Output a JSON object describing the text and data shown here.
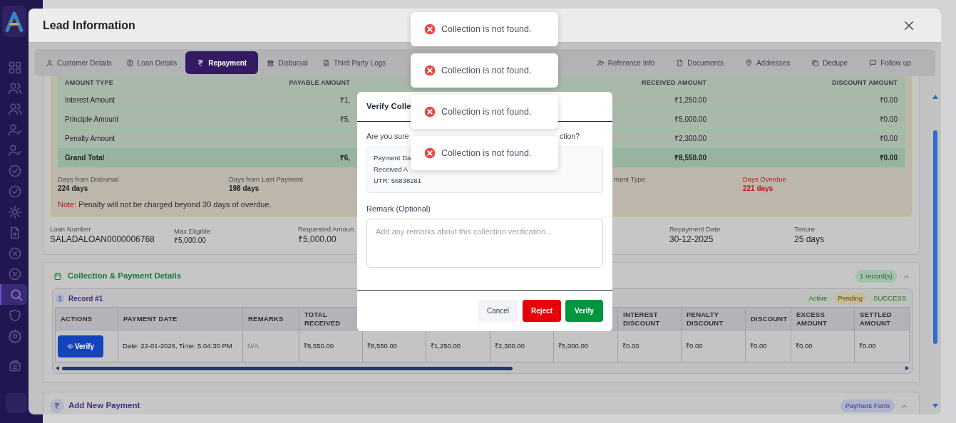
{
  "sidebar": {
    "items": [
      {
        "kind": "grid",
        "selected": false
      },
      {
        "kind": "users",
        "selected": false
      },
      {
        "kind": "users",
        "selected": false
      },
      {
        "kind": "user-check",
        "selected": false
      },
      {
        "kind": "user-check",
        "selected": false
      },
      {
        "kind": "check-circle",
        "selected": false
      },
      {
        "kind": "check-circle",
        "selected": false
      },
      {
        "kind": "sun",
        "selected": false
      },
      {
        "kind": "file",
        "selected": false
      },
      {
        "kind": "x-circle",
        "selected": false
      },
      {
        "kind": "x-circle",
        "selected": false
      },
      {
        "kind": "search",
        "selected": true
      },
      {
        "kind": "shield",
        "selected": false
      },
      {
        "kind": "settings",
        "selected": false
      },
      {
        "kind": "building",
        "selected": false
      }
    ]
  },
  "lead": {
    "title": "Lead Information",
    "tabs": [
      {
        "label": "Customer Details",
        "kind": "user",
        "selected": false
      },
      {
        "label": "Loan Details",
        "kind": "loan",
        "selected": false
      },
      {
        "label": "Repayment",
        "kind": "rupee",
        "selected": true
      },
      {
        "label": "Disbursal",
        "kind": "bank",
        "selected": false
      },
      {
        "label": "Third Party Logs",
        "kind": "logs",
        "selected": false
      },
      {
        "label": "Reference Info",
        "kind": "user-plus",
        "selected": false
      },
      {
        "label": "Documents",
        "kind": "document",
        "selected": false
      },
      {
        "label": "Addresses",
        "kind": "pin",
        "selected": false
      },
      {
        "label": "Dedupe",
        "kind": "copy",
        "selected": false
      },
      {
        "label": "Follow up",
        "kind": "message",
        "selected": false
      }
    ],
    "summary": {
      "columns": [
        "AMOUNT TYPE",
        "PAYABLE AMOUNT",
        "RECEIVED AMOUNT",
        "DISCOUNT AMOUNT"
      ],
      "rows": [
        {
          "label": "Interest Amount",
          "payable": "₹1,",
          "received": "₹1,250.00",
          "discount": "₹0.00",
          "kind": "item"
        },
        {
          "label": "Principle Amount",
          "payable": "₹5,",
          "received": "₹5,000.00",
          "discount": "₹0.00",
          "kind": "item"
        },
        {
          "label": "Penalty Amount",
          "received": "₹2,300.00",
          "discount": "₹0.00",
          "kind": "item"
        },
        {
          "label": "Grand Total",
          "payable": "₹6,",
          "received": "₹8,550.00",
          "discount": "₹0.00",
          "kind": "total"
        }
      ]
    },
    "stats": [
      {
        "label": "Days from Disbursal",
        "value": "224 days",
        "alert": false
      },
      {
        "label": "Days from Last Payment",
        "value": "198 days",
        "alert": false
      },
      {
        "label": "ment Type",
        "alert": false
      },
      {
        "label": "Days Overdue",
        "value": "221 days",
        "alert": true
      }
    ],
    "note": {
      "label": "Note:",
      "text": "Penalty will not be charged beyond 30 days of overdue."
    },
    "loan_info": [
      {
        "label": "Loan Number",
        "value": "SALADALOAN0000006768",
        "kind": "large"
      },
      {
        "label": "Max Eligible",
        "value": "₹5,000.00",
        "kind": "small"
      },
      {
        "label": "Requested Amoun",
        "value": "₹5,000.00",
        "kind": "large"
      },
      {
        "label": "Repayment Date",
        "value": "30-12-2025",
        "kind": "large"
      },
      {
        "label": "Tenure",
        "value": "25 days",
        "kind": "large"
      }
    ],
    "collection": {
      "title": "Collection & Payment Details",
      "badge": "1 record(s)",
      "expanded": true,
      "record": {
        "number": "1",
        "title": "Record #1",
        "statuses": [
          {
            "label": "Active",
            "color": "#b4c6b4"
          },
          {
            "label": "Pending",
            "color": "#c9bd8e"
          },
          {
            "label": "SUCCESS",
            "color": "#b4c6b4"
          }
        ]
      },
      "columns": [
        "ACTIONS",
        "PAYMENT DATE",
        "REMARKS",
        "TOTAL RECEIVED",
        "",
        "",
        "",
        "",
        "INTEREST DISCOUNT",
        "PENALTY DISCOUNT",
        "DISCOUNT",
        "EXCESS AMOUNT",
        "SETTLED AMOUNT"
      ],
      "rows": [
        {
          "cells": [
            "Verify",
            "Date: 22-01-2026, Time: 5:04:30 PM",
            "N/A",
            "₹8,550.00",
            "₹8,550.00",
            "₹1,250.00",
            "₹2,300.00",
            "₹5,000.00",
            "₹0.00",
            "₹0.00",
            "₹0.00",
            "₹0.00",
            "₹0.00"
          ]
        }
      ]
    },
    "add_payment": {
      "title": "Add New Payment",
      "badge": "Payment Form",
      "expanded": true
    }
  },
  "verify_dialog": {
    "title": "Verify Colle",
    "question": "Are you sure",
    "question_tail": "ction?",
    "details": [
      "Payment Da",
      "Received A",
      "UTR: 56838281"
    ],
    "remark_label": "Remark (Optional)",
    "remark_placeholder": "Add any remarks about this collection verification...",
    "buttons": [
      {
        "label": "Cancel",
        "kind": "cancel"
      },
      {
        "label": "Reject",
        "kind": "reject"
      },
      {
        "label": "Verify",
        "kind": "verify"
      }
    ]
  },
  "toasts": [
    {
      "message": "Collection is not found.",
      "kind": "error"
    },
    {
      "message": "Collection is not found.",
      "kind": "error"
    },
    {
      "message": "Collection is not found.",
      "kind": "error"
    },
    {
      "message": "Collection is not found.",
      "kind": "error"
    }
  ]
}
